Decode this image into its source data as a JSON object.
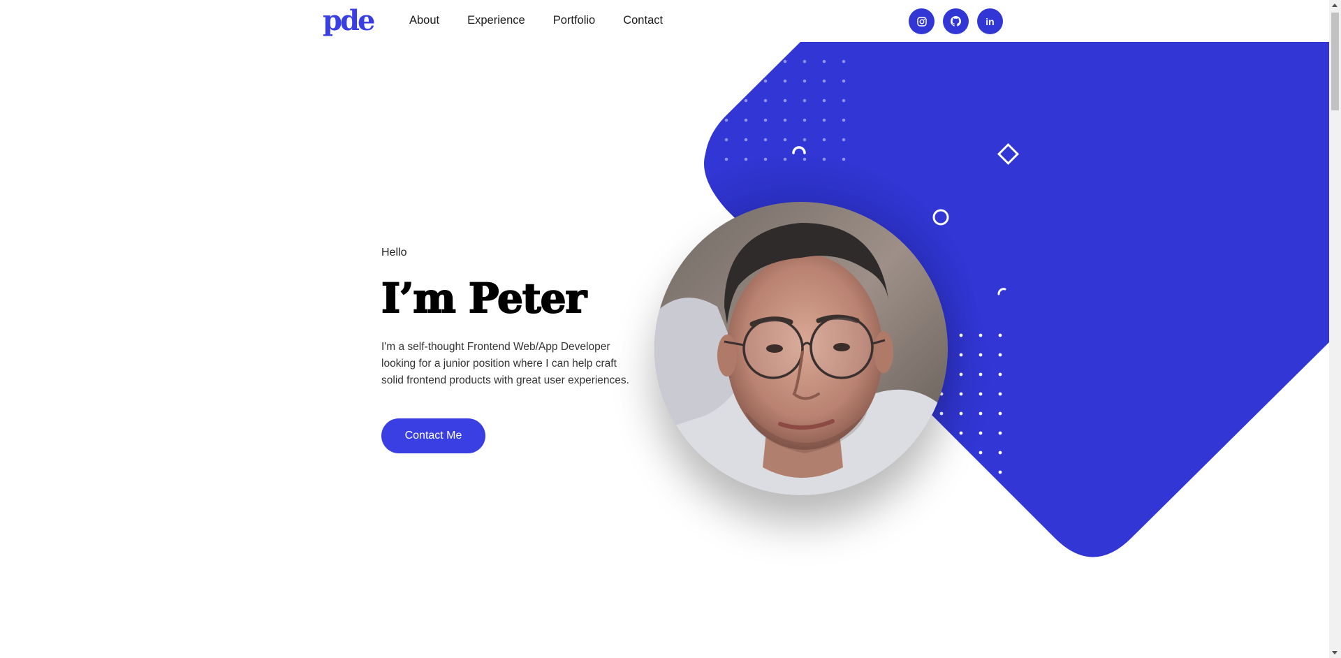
{
  "brand": {
    "logo_text": "pde",
    "accent": "#3a3fe3",
    "shape_color": "#3136d4"
  },
  "nav": {
    "links": [
      {
        "label": "About"
      },
      {
        "label": "Experience"
      },
      {
        "label": "Portfolio"
      },
      {
        "label": "Contact"
      }
    ],
    "social": [
      {
        "icon": "instagram-icon"
      },
      {
        "icon": "github-icon"
      },
      {
        "icon": "linkedin-icon",
        "glyph": "in"
      }
    ]
  },
  "hero": {
    "greeting": "Hello",
    "headline": "I’m Peter",
    "description": "I'm a self-thought Frontend Web/App Developer looking for a junior position where I can help craft solid frontend products with great user experiences.",
    "cta_label": "Contact Me"
  }
}
